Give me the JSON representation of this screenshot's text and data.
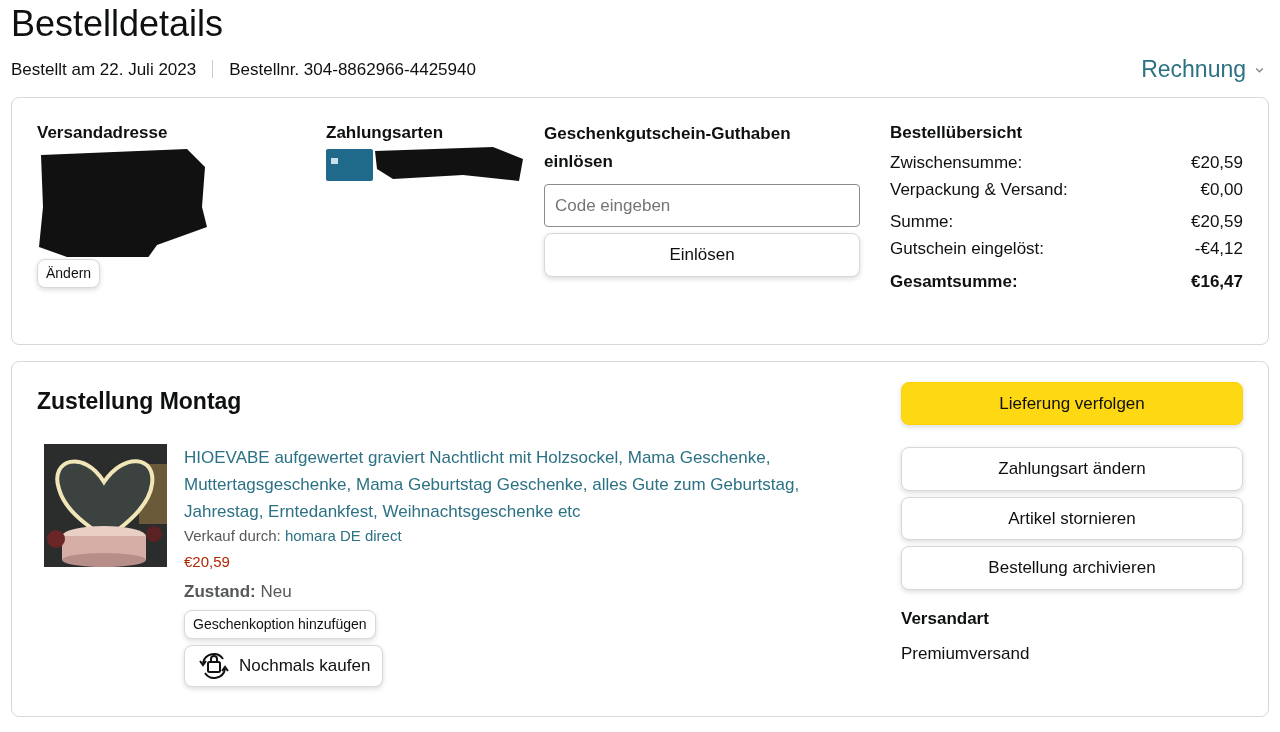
{
  "title": "Bestelldetails",
  "order_meta": {
    "date": "Bestellt am 22. Juli 2023",
    "number": "Bestellnr. 304-8862966-4425940",
    "invoice": "Rechnung"
  },
  "summary_card": {
    "shipping_address": {
      "heading": "Versandadresse",
      "redacted": true,
      "button": "Ändern"
    },
    "payment": {
      "heading": "Zahlungsarten",
      "redacted": true
    },
    "gift_card": {
      "heading": "Geschenkgutschein-Guthaben einlösen",
      "placeholder": "Code eingeben",
      "button": "Einlösen"
    },
    "order_summary": {
      "heading": "Bestellübersicht",
      "lines": [
        {
          "label": "Zwischensumme:",
          "value": "€20,59",
          "kind": "normal"
        },
        {
          "label": "Verpackung & Versand:",
          "value": "€0,00",
          "kind": "normal"
        },
        {
          "label": "Summe:",
          "value": "€20,59",
          "kind": "gap"
        },
        {
          "label": "Gutschein eingelöst:",
          "value": "-€4,12",
          "kind": "normal"
        },
        {
          "label": "Gesamtsumme:",
          "value": "€16,47",
          "kind": "total"
        }
      ]
    }
  },
  "delivery": {
    "heading": "Zustellung Montag",
    "item": {
      "title": "HIOEVABE aufgewertet graviert Nachtlicht mit Holzsockel, Mama Geschenke, Muttertagsgeschenke, Mama Geburtstag Geschenke, alles Gute zum Geburtstag, Jahrestag, Erntedankfest, Weihnachtsgeschenke etc",
      "seller_label": "Verkauf durch:",
      "seller": "homara DE direct",
      "price": "€20,59",
      "condition_label": "Zustand:",
      "condition": "Neu",
      "gift_button": "Geschenkoption hinzufügen",
      "buy_again_button": "Nochmals kaufen"
    },
    "actions": [
      {
        "label": "Lieferung verfolgen",
        "kind": "primary"
      },
      {
        "label": "Zahlungsart ändern",
        "kind": "secondary"
      },
      {
        "label": "Artikel stornieren",
        "kind": "secondary"
      },
      {
        "label": "Bestellung archivieren",
        "kind": "secondary"
      }
    ],
    "shipping_method": {
      "heading": "Versandart",
      "value": "Premiumversand"
    }
  }
}
